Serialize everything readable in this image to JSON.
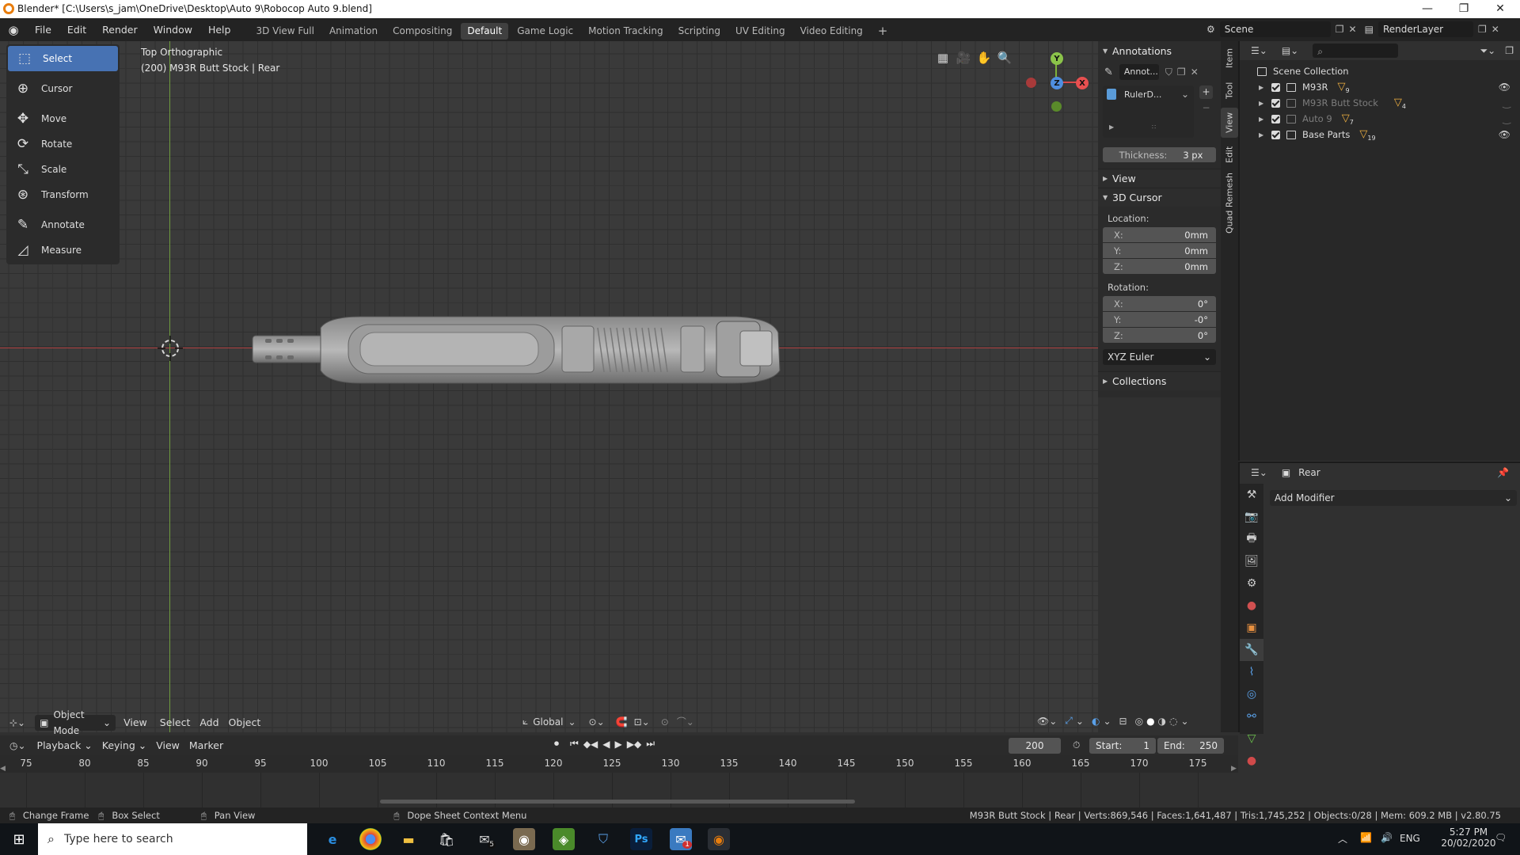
{
  "window": {
    "title": "Blender* [C:\\Users\\s_jam\\OneDrive\\Desktop\\Auto 9\\Robocop Auto 9.blend]",
    "minimize": "—",
    "restore": "❐",
    "close": "✕"
  },
  "menu": [
    "File",
    "Edit",
    "Render",
    "Window",
    "Help"
  ],
  "workspaces": [
    "3D View Full",
    "Animation",
    "Compositing",
    "Default",
    "Game Logic",
    "Motion Tracking",
    "Scripting",
    "UV Editing",
    "Video Editing"
  ],
  "active_workspace": "Default",
  "add_workspace": "+",
  "scene": {
    "name": "Scene",
    "view_layer": "RenderLayer"
  },
  "toolbar": [
    {
      "label": "Select",
      "icon": "select-box-icon",
      "glyph": "⬚",
      "active": true
    },
    {
      "label": "Cursor",
      "icon": "cursor-icon",
      "glyph": "⊕",
      "active": false
    },
    {
      "label": "Move",
      "icon": "move-icon",
      "glyph": "✥",
      "active": false
    },
    {
      "label": "Rotate",
      "icon": "rotate-icon",
      "glyph": "⟳",
      "active": false
    },
    {
      "label": "Scale",
      "icon": "scale-icon",
      "glyph": "⤡",
      "active": false
    },
    {
      "label": "Transform",
      "icon": "transform-icon",
      "glyph": "⊛",
      "active": false
    },
    {
      "label": "Annotate",
      "icon": "annotate-icon",
      "glyph": "✎",
      "active": false
    },
    {
      "label": "Measure",
      "icon": "measure-icon",
      "glyph": "📐",
      "active": false
    }
  ],
  "viewport": {
    "view_name": "Top Orthographic",
    "object_info": "(200) M93R Butt Stock | Rear",
    "gizmo": {
      "x": "X",
      "y": "Y",
      "z": "Z"
    },
    "header": {
      "mode": "Object Mode",
      "menus": [
        "View",
        "Select",
        "Add",
        "Object"
      ],
      "orientation": "Global"
    }
  },
  "npanel": {
    "annotations": {
      "title": "Annotations",
      "layer_name": "Annot...",
      "item": "RulerD...",
      "thickness_label": "Thickness:",
      "thickness_value": "3 px"
    },
    "view_title": "View",
    "cursor": {
      "title": "3D Cursor",
      "location_label": "Location:",
      "location": [
        {
          "axis": "X:",
          "value": "0mm"
        },
        {
          "axis": "Y:",
          "value": "0mm"
        },
        {
          "axis": "Z:",
          "value": "0mm"
        }
      ],
      "rotation_label": "Rotation:",
      "rotation": [
        {
          "axis": "X:",
          "value": "0°"
        },
        {
          "axis": "Y:",
          "value": "-0°"
        },
        {
          "axis": "Z:",
          "value": "0°"
        }
      ],
      "rotation_mode": "XYZ Euler"
    },
    "collections_title": "Collections",
    "tabs": [
      "Item",
      "Tool",
      "View",
      "Edit",
      "Quad Remesh"
    ],
    "active_tab": "View"
  },
  "outliner": {
    "root": "Scene Collection",
    "items": [
      {
        "name": "M93R",
        "count": "9",
        "dim": false
      },
      {
        "name": "M93R Butt Stock",
        "count": "4",
        "dim": true
      },
      {
        "name": "Auto 9",
        "count": "7",
        "dim": true
      },
      {
        "name": "Base Parts",
        "count": "19",
        "dim": false
      }
    ]
  },
  "properties": {
    "object_name": "Rear",
    "add_modifier": "Add Modifier"
  },
  "timeline": {
    "menus": [
      "Playback",
      "Keying",
      "View",
      "Marker"
    ],
    "current_frame": "200",
    "start_label": "Start:",
    "start": "1",
    "end_label": "End:",
    "end": "250",
    "ruler": [
      "75",
      "80",
      "85",
      "90",
      "95",
      "100",
      "105",
      "110",
      "115",
      "120",
      "125",
      "130",
      "135",
      "140",
      "145",
      "150",
      "155",
      "160",
      "165",
      "170",
      "175"
    ]
  },
  "statusbar": {
    "change_frame": "Change Frame",
    "box_select": "Box Select",
    "pan_view": "Pan View",
    "context_menu": "Dope Sheet Context Menu",
    "stats": "M93R Butt Stock | Rear | Verts:869,546 | Faces:1,641,487 | Tris:1,745,252 | Objects:0/28 | Mem: 609.2 MB | v2.80.75"
  },
  "taskbar": {
    "search_placeholder": "Type here to search",
    "lang": "ENG",
    "time": "5:27 PM",
    "date": "20/02/2020",
    "mail_badge": "5",
    "app_badge": "1"
  }
}
